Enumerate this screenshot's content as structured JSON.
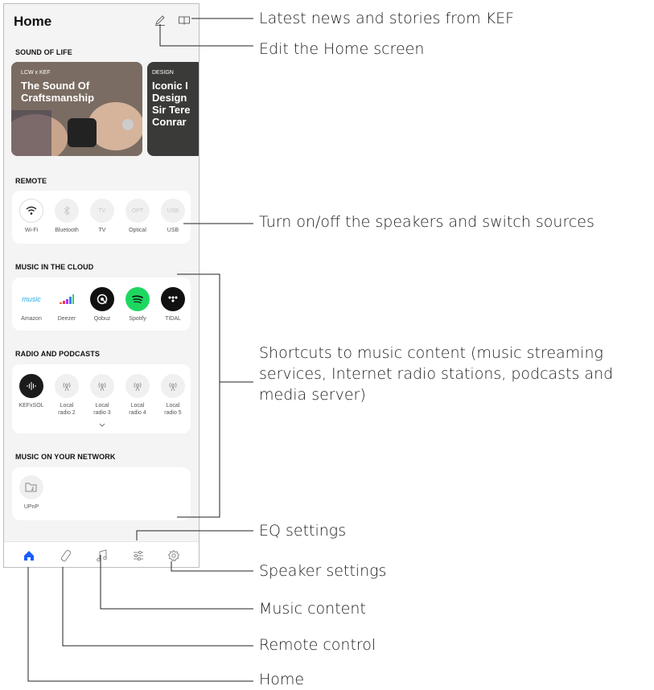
{
  "header": {
    "title": "Home"
  },
  "sound_of_life": {
    "title": "SOUND OF LIFE",
    "cards": [
      {
        "tag": "LCW x KEF",
        "title_line1": "The Sound Of",
        "title_line2": "Craftsmanship"
      },
      {
        "tag": "DESIGN",
        "title_line1": "Iconic I",
        "title_line2": "Design",
        "title_line3": "Sir Tere",
        "title_line4": "Conrar"
      }
    ]
  },
  "remote": {
    "title": "REMOTE",
    "sources": [
      {
        "label": "Wi-Fi",
        "icon": "wifi-icon"
      },
      {
        "label": "Bluetooth",
        "icon": "bluetooth-icon"
      },
      {
        "label": "TV",
        "icon_text": "TV"
      },
      {
        "label": "Optical",
        "icon_text": "OPT"
      },
      {
        "label": "USB",
        "icon_text": "USB"
      }
    ]
  },
  "cloud": {
    "title": "MUSIC IN THE CLOUD",
    "services": [
      {
        "label": "Amazon",
        "logo_text": "music"
      },
      {
        "label": "Deezer"
      },
      {
        "label": "Qobuz"
      },
      {
        "label": "Spotify"
      },
      {
        "label": "TIDAL"
      }
    ]
  },
  "radio": {
    "title": "RADIO AND PODCASTS",
    "stations": [
      {
        "label": "KEFxSOL"
      },
      {
        "label_line1": "Local",
        "label_line2": "radio 2"
      },
      {
        "label_line1": "Local",
        "label_line2": "radio 3"
      },
      {
        "label_line1": "Local",
        "label_line2": "radio 4"
      },
      {
        "label_line1": "Local",
        "label_line2": "radio 5"
      }
    ]
  },
  "network": {
    "title": "MUSIC ON YOUR NETWORK",
    "items": [
      {
        "label": "UPnP"
      }
    ]
  },
  "annotations": {
    "news": "Latest news and stories from KEF",
    "edit": "Edit the Home screen",
    "remote": "Turn on/off the speakers and switch sources",
    "shortcuts_line1": "Shortcuts to music content (music streaming",
    "shortcuts_line2": "services, Internet radio stations, podcasts and",
    "shortcuts_line3": "media server)",
    "eq": "EQ settings",
    "speaker": "Speaker settings",
    "music": "Music content",
    "remote_control": "Remote control",
    "home": "Home"
  },
  "colors": {
    "accent": "#1a5cff",
    "spotify": "#1ed760",
    "line": "#222222"
  }
}
